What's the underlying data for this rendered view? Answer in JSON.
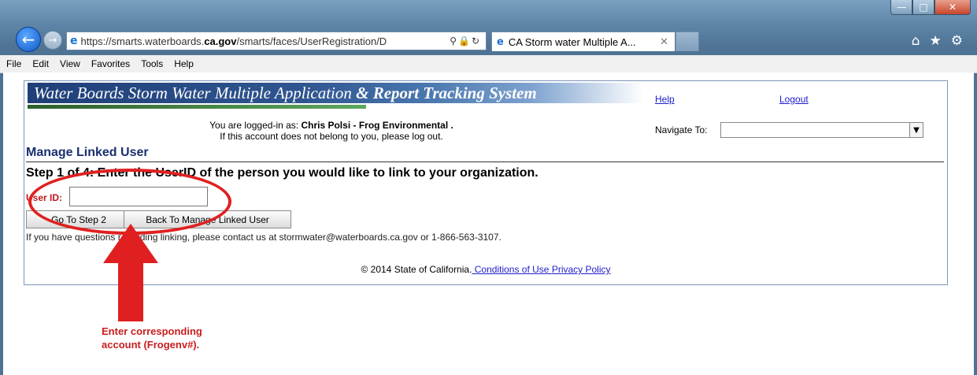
{
  "browser": {
    "url": "https://smarts.waterboards.ca.gov/smarts/faces/UserRegistration/D",
    "url_prefix": "https://smarts.waterboards.",
    "url_domain": "ca.gov",
    "url_suffix": "/smarts/faces/UserRegistration/D",
    "tab_title": "CA Storm water Multiple A...",
    "menu": [
      "File",
      "Edit",
      "View",
      "Favorites",
      "Tools",
      "Help"
    ]
  },
  "app": {
    "banner_title": "Water Boards  Storm Water Multiple Application ",
    "banner_title_2": "& Report Tracking System",
    "help_link": "Help",
    "logout_link": "Logout",
    "login_prefix": "You are logged-in as: ",
    "login_user": "Chris Polsi - Frog Environmental .",
    "login_note": "If this account does not belong to you, please log out.",
    "navigate_label": "Navigate To:",
    "navigate_value": ""
  },
  "page": {
    "title": "Manage Linked User",
    "step_text": "Step 1 of 4: Enter the UserID of the person you would like to link to your organization.",
    "userid_label": "User ID:",
    "userid_value": "",
    "next_button": "Go To Step 2",
    "back_button": "Back To Manage Linked User",
    "contact_text": "If you have questions regarding linking, please contact us at stormwater@waterboards.ca.gov or 1-866-563-3107."
  },
  "footer": {
    "copyright": "© 2014 State of California.",
    "conditions_link": " Conditions of Use ",
    "privacy_link": " Privacy Policy "
  },
  "annotation": {
    "text_line1": "Enter corresponding",
    "text_line2": "account (Frogenv#).",
    "color": "#e02020"
  }
}
